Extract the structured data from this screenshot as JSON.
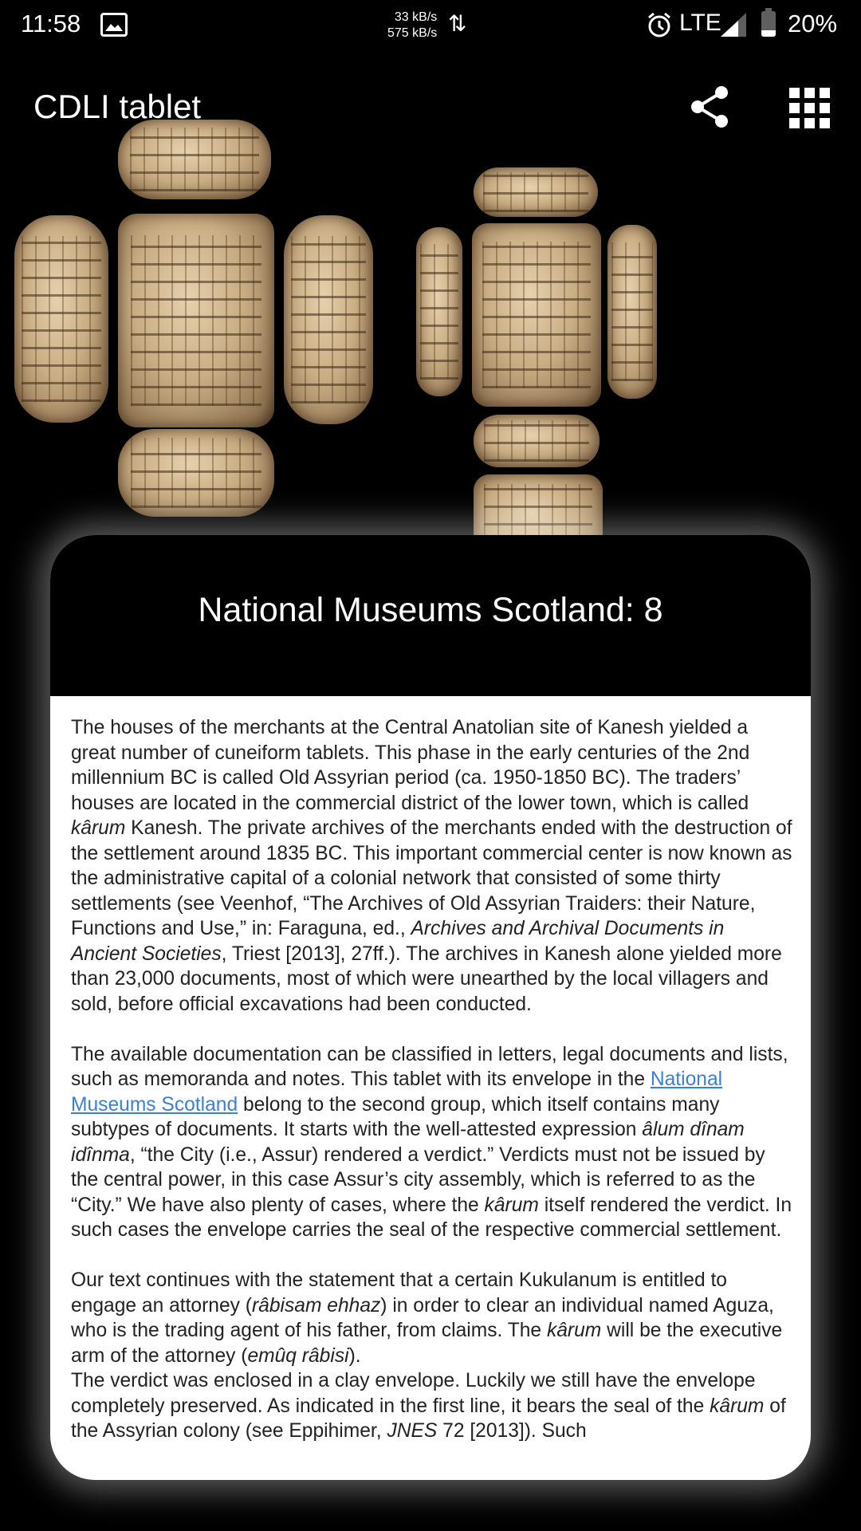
{
  "status_bar": {
    "time": "11:58",
    "speed_up": "33 kB/s",
    "speed_down": "575 kB/s",
    "network": "LTE",
    "battery": "20%",
    "battery_level": 0.2
  },
  "app_bar": {
    "title": "CDLI tablet",
    "share_icon": "share-icon",
    "grid_icon": "apps-grid-icon"
  },
  "card": {
    "title": "National Museums Scotland: 8",
    "p1": {
      "a": "The houses of the merchants at the Central Anatolian site of Kanesh yielded a great number of cuneiform tablets. This phase in the early centuries of the 2nd millennium BC is called Old Assyrian period (ca. 1950-1850 BC). The traders’ houses are located in the commercial district of the lower town, which is called ",
      "karum": "kârum",
      "b": " Kanesh. The private archives of the merchants ended with the destruction of the settlement around 1835 BC. This important commercial center is now known as the administrative capital of a colonial network that consisted of some thirty settlements (see Veenhof, “The Archives of Old Assyrian Traiders: their Nature, Functions and Use,” in: Faraguna, ed., ",
      "book": "Archives and Archival Documents in Ancient Societies",
      "c": ", Triest [2013], 27ff.). The archives in Kanesh alone yielded more than 23,000 documents, most of which were unearthed by the local villagers and sold, before official excavations had been conducted."
    },
    "p2": {
      "a": "The available documentation can be classified in letters, legal documents and lists, such as memoranda and notes. This tablet with its envelope in the ",
      "link": "National Museums Scotland",
      "b": " belong to the second group, which itself contains many subtypes of documents. It starts with the well-attested expression ",
      "phrase": "âlum dînam idînma",
      "c": ", “the City (i.e., Assur) rendered a verdict.” Verdicts must not be issued by the central power, in this case Assur’s city assembly, which is referred to as the “City.” We have also plenty of cases, where the ",
      "karum": "kârum",
      "d": " itself rendered the verdict. In such cases the envelope carries the seal of the respective commercial settlement."
    },
    "p3": {
      "a": "Our text continues with the statement that a certain Kukulanum is entitled to engage an attorney (",
      "rabisam": "râbisam ehhaz",
      "b": ") in order to clear an individual named Aguza, who is the trading agent of his father, from claims. The ",
      "karum": "kârum",
      "c": " will be the executive arm of the attorney (",
      "emuq": "emûq râbisi",
      "d": ")."
    },
    "p4": {
      "a": "The verdict was enclosed in a clay envelope. Luckily we still have the envelope completely preserved. As indicated in the first line, it bears the seal of the ",
      "karum": "kârum",
      "b": " of the Assyrian colony (see Eppihimer, ",
      "ref": "JNES",
      "c": " 72 [2013]). Such"
    }
  }
}
